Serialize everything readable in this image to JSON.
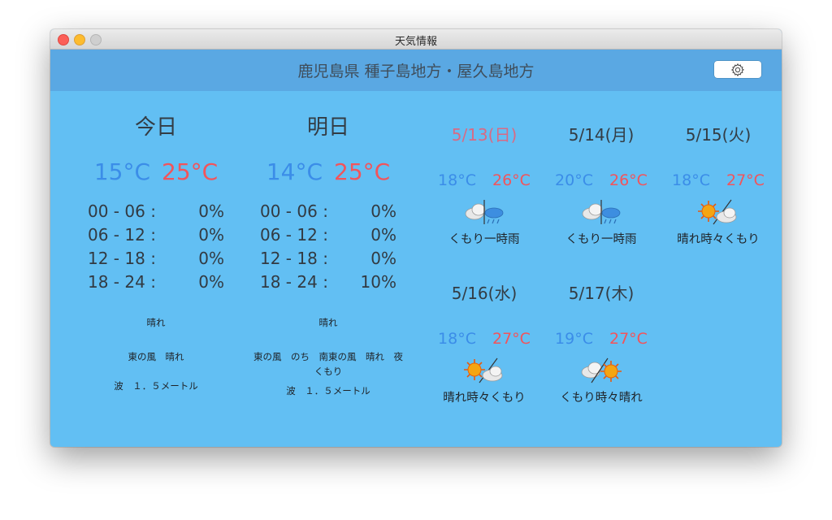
{
  "window": {
    "title": "天気情報"
  },
  "header": {
    "region": "鹿児島県 種子島地方・屋久島地方"
  },
  "colors": {
    "min_temp": "#3b8de8",
    "max_temp": "#f2545b",
    "sunday": "#d96a84",
    "header_bg": "#5aa8e3",
    "body_bg": "#62bff3"
  },
  "today": {
    "title": "今日",
    "min": "15°C",
    "max": "25°C",
    "rain": [
      {
        "range": "00 - 06 :",
        "pct": "0%"
      },
      {
        "range": "06 - 12 :",
        "pct": "0%"
      },
      {
        "range": "12 - 18 :",
        "pct": "0%"
      },
      {
        "range": "18 - 24 :",
        "pct": "0%"
      }
    ],
    "weather": "晴れ",
    "wind": "東の風　晴れ",
    "wave": "波　１．５メートル"
  },
  "tomorrow": {
    "title": "明日",
    "min": "14°C",
    "max": "25°C",
    "rain": [
      {
        "range": "00 - 06 :",
        "pct": "0%"
      },
      {
        "range": "06 - 12 :",
        "pct": "0%"
      },
      {
        "range": "12 - 18 :",
        "pct": "0%"
      },
      {
        "range": "18 - 24 :",
        "pct": "10%"
      }
    ],
    "weather": "晴れ",
    "wind": "東の風　のち　南東の風　晴れ　夜\nくもり",
    "wave": "波　１．５メートル"
  },
  "forecast": [
    {
      "date": "5/13(日)",
      "min": "18°C",
      "max": "26°C",
      "icon": "cloud-rain-icon",
      "label": "くもり一時雨"
    },
    {
      "date": "5/14(月)",
      "min": "20°C",
      "max": "26°C",
      "icon": "cloud-rain-icon",
      "label": "くもり一時雨"
    },
    {
      "date": "5/15(火)",
      "min": "18°C",
      "max": "27°C",
      "icon": "sun-cloud-icon",
      "label": "晴れ時々くもり"
    },
    {
      "date": "5/16(水)",
      "min": "18°C",
      "max": "27°C",
      "icon": "sun-cloud-icon",
      "label": "晴れ時々くもり"
    },
    {
      "date": "5/17(木)",
      "min": "19°C",
      "max": "27°C",
      "icon": "cloud-sun-icon",
      "label": "くもり時々晴れ"
    }
  ]
}
